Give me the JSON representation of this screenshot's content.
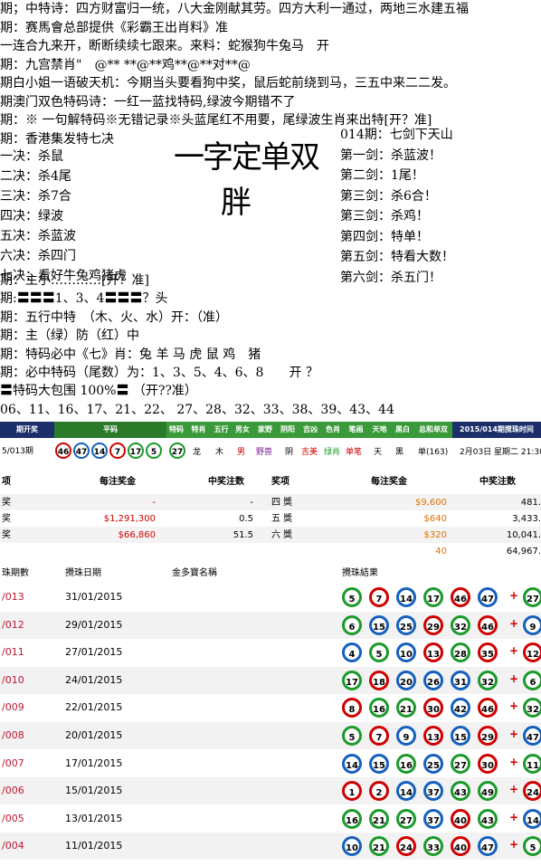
{
  "colors": {
    "red": "#d00000",
    "blue": "#1560bd",
    "green": "#1a9a2a",
    "darkblue": "#1b2f6b",
    "orange": "#e07000"
  },
  "text_lines": [
    "期；中特诗：四方财富归一统，八大金刚献其劳。四方大利一通过，两地三水建五福",
    "期：赛馬會总部提供《彩霸王出肖料》准",
    "一连合九来开，断断续续七跟来。来料：蛇猴狗牛兔马　开",
    "期：九宫禁肖\"　@** **@**鸡**@**对**@",
    "期白小姐一语破天机：今期当头要看狗中奖，鼠后蛇前绕到马，三五中来二二发。",
    "期澳门双色特码诗：一红一蓝找特码,绿波今期错不了",
    "期：※ 一句解特码※无错记录※头蓝尾红不用要，尾绿波生肖来出特[开？准]",
    "期：香港集发特七决"
  ],
  "left_col": [
    "一决：杀鼠",
    "二决：杀4尾",
    "三决：杀7合",
    "四决：绿波",
    "五决：杀蓝波",
    "六决：杀四门",
    "七决：看好牛兔鸡猪虎"
  ],
  "center_big": [
    "一字定单双",
    "胖"
  ],
  "right_col": [
    "014期：七剑下天山",
    "第一剑：杀蓝波！",
    "第二剑：1尾！",
    "第三剑：杀6合！",
    "第三剑：杀鸡！",
    "第四剑：特单！",
    "第五剑：特看大数！",
    "第六剑：杀五门！"
  ],
  "more_lines": [
    "期：主小…………[开？准]",
    "期:〓〓〓1、3、4〓〓〓？头",
    "期：五行中特　（木、火、水）开：（准）",
    "期：主（绿）防（红）中",
    "期：特码必中《七》肖：兔 羊 马 虎 鼠 鸡　猪",
    "期：必中特码（尾数）为：1、3、5、4、6、8　　开 ？",
    "〓特码大包围 100%〓 （开??准）",
    "  06、11、16、17、21、22、 27、28、32、33、38、39、43、44"
  ],
  "header_cells": [
    "期开奖",
    "平码",
    "特码",
    "特肖",
    "五行",
    "男女",
    "家野",
    "阴阳",
    "吉凶",
    "色肖",
    "笔画",
    "天地",
    "黑白",
    "总和单双",
    "2015/014期搅珠时间"
  ],
  "header_values": {
    "period": "5/013期",
    "plain": [
      "46",
      "47",
      "14",
      "7",
      "17",
      "5"
    ],
    "special": "27",
    "zodiac": "龙",
    "element": "木",
    "gender": "男",
    "home": "野兽",
    "yinyang": "阴",
    "luck": "吉美",
    "color": "绿肖",
    "strokes": "单笔",
    "sky": "天",
    "bw": "黑",
    "sum": "单(163)",
    "next": "2月03日 星期二 21:30"
  },
  "prize_headers": {
    "left": [
      "项",
      "每注奖金",
      "中奖注数"
    ],
    "right": [
      "奖项",
      "每注奖金",
      "中奖注数"
    ]
  },
  "prizes_left": [
    {
      "name": "奖",
      "amount": "-",
      "count": "-"
    },
    {
      "name": "奖",
      "amount": "$1,291,300",
      "count": "0.5"
    },
    {
      "name": "奖",
      "amount": "$66,860",
      "count": "51.5"
    }
  ],
  "prizes_right": [
    {
      "name": "四 獎",
      "amount": "$9,600",
      "count": "481."
    },
    {
      "name": "五 獎",
      "amount": "$640",
      "count": "3,433."
    },
    {
      "name": "六 獎",
      "amount": "$320",
      "count": "10,041."
    },
    {
      "name": "",
      "amount": "40",
      "count": "64,967."
    }
  ],
  "history_headers": [
    "珠期數",
    "攪珠日期",
    "金多寶名稱",
    "攪珠結果"
  ],
  "history": [
    {
      "id": "/013",
      "date": "31/01/2015",
      "balls": [
        "5",
        "7",
        "14",
        "17",
        "46",
        "47"
      ],
      "special": "27"
    },
    {
      "id": "/012",
      "date": "29/01/2015",
      "balls": [
        "6",
        "15",
        "25",
        "29",
        "32",
        "46"
      ],
      "special": "9"
    },
    {
      "id": "/011",
      "date": "27/01/2015",
      "balls": [
        "4",
        "5",
        "10",
        "13",
        "28",
        "35"
      ],
      "special": "12"
    },
    {
      "id": "/010",
      "date": "24/01/2015",
      "balls": [
        "17",
        "18",
        "20",
        "26",
        "31",
        "32"
      ],
      "special": "6"
    },
    {
      "id": "/009",
      "date": "22/01/2015",
      "balls": [
        "8",
        "16",
        "21",
        "30",
        "42",
        "46"
      ],
      "special": "32"
    },
    {
      "id": "/008",
      "date": "20/01/2015",
      "balls": [
        "5",
        "7",
        "9",
        "13",
        "15",
        "29"
      ],
      "special": "47"
    },
    {
      "id": "/007",
      "date": "17/01/2015",
      "balls": [
        "14",
        "15",
        "16",
        "25",
        "27",
        "30"
      ],
      "special": "11"
    },
    {
      "id": "/006",
      "date": "15/01/2015",
      "balls": [
        "1",
        "2",
        "14",
        "37",
        "43",
        "49"
      ],
      "special": "24"
    },
    {
      "id": "/005",
      "date": "13/01/2015",
      "balls": [
        "16",
        "21",
        "27",
        "37",
        "40",
        "43"
      ],
      "special": "14"
    },
    {
      "id": "/004",
      "date": "11/01/2015",
      "balls": [
        "10",
        "21",
        "24",
        "33",
        "40",
        "47"
      ],
      "special": "5"
    }
  ]
}
